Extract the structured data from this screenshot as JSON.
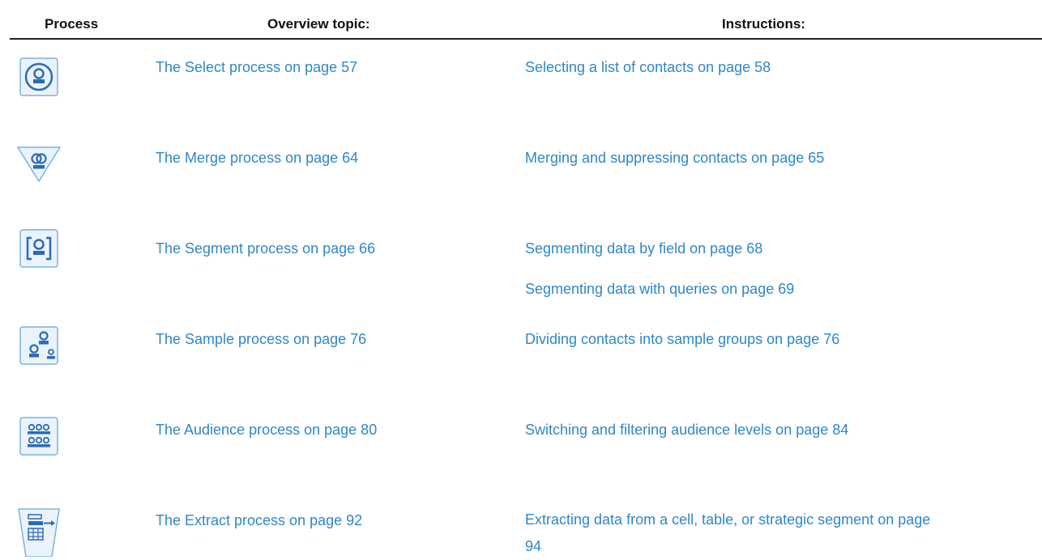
{
  "table": {
    "headers": {
      "process": "Process",
      "overview": "Overview topic:",
      "instructions": "Instructions:"
    },
    "rows": [
      {
        "icon": "select-process-icon",
        "overview": "The Select process on page 57",
        "instructions": [
          "Selecting a list of contacts on page 58"
        ]
      },
      {
        "icon": "merge-process-icon",
        "overview": "The Merge process on page 64",
        "instructions": [
          "Merging and suppressing contacts on page 65"
        ]
      },
      {
        "icon": "segment-process-icon",
        "overview": "The Segment process on page 66",
        "instructions": [
          "Segmenting data by field on page 68",
          "Segmenting data with queries on page 69"
        ]
      },
      {
        "icon": "sample-process-icon",
        "overview": "The Sample process on page 76",
        "instructions": [
          "Dividing contacts into sample groups on page 76"
        ]
      },
      {
        "icon": "audience-process-icon",
        "overview": "The Audience process on page 80",
        "instructions": [
          "Switching and filtering audience levels on page 84"
        ]
      },
      {
        "icon": "extract-process-icon",
        "overview": "The Extract process on page 92",
        "instructions": [
          "Extracting data from a cell, table, or strategic segment on page 94"
        ]
      }
    ]
  },
  "colors": {
    "link": "#2f87c8",
    "icon_fill": "#2c6bb5",
    "icon_border": "#7bb2e0",
    "icon_bg": "#eaf3fb"
  }
}
